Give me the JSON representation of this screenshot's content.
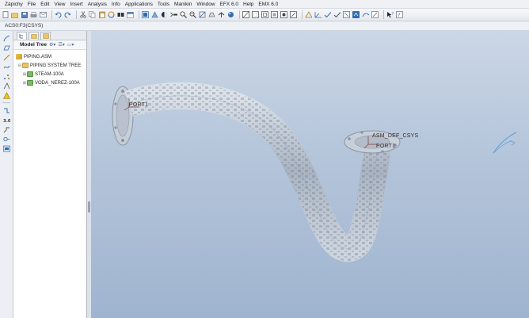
{
  "menu": [
    "Zápichy",
    "File",
    "Edit",
    "View",
    "Insert",
    "Analysis",
    "Info",
    "Applications",
    "Tools",
    "Manikin",
    "Window",
    "EFX 6.0",
    "Help",
    "EMX 6.0"
  ],
  "infobar": {
    "text": "ACS0:F3(CSYS)"
  },
  "tree": {
    "header": "Model Tree",
    "items": [
      {
        "label": "PIPING.ASM",
        "level": 0
      },
      {
        "label": "PIPING SYSTEM TREE",
        "level": 1
      },
      {
        "label": "STEAM-100A",
        "level": 2
      },
      {
        "label": "VODA_NEREZ-100A",
        "level": 2
      }
    ]
  },
  "viewport": {
    "labels": {
      "port1": "PORT1",
      "csys": "ASM_DEF_CSYS",
      "port2": "PORT1"
    }
  },
  "icons": {
    "toolbar": [
      "new-icon",
      "open-icon",
      "save-icon",
      "print-icon",
      "email-icon",
      "undo-icon",
      "redo-icon",
      "cut-icon",
      "copy-icon",
      "paste-icon",
      "regenerate-icon",
      "find-icon",
      "window-icon",
      "shade-icon",
      "repaint-icon",
      "spin-center-icon",
      "zoom-in-icon",
      "zoom-out-icon",
      "refit-icon",
      "reorient-icon",
      "saved-views-icon",
      "layers-icon",
      "appearance-icon",
      "wireframe-icon",
      "hidden-line-icon",
      "no-hidden-icon",
      "shading-icon",
      "datum-planes-icon",
      "datum-axes-icon",
      "datum-points-icon",
      "csys-icon",
      "annotations-icon",
      "context-help-icon"
    ],
    "left": [
      "sketch-icon",
      "arc-icon",
      "line-icon",
      "curve-icon",
      "point-icon",
      "axis-icon",
      "warning-icon",
      "route-icon",
      "dimension-icon",
      "fitting-icon",
      "flange-icon",
      "pipe-info-icon"
    ]
  },
  "colors": {
    "accent": "#2f6db3",
    "pipe": "#aeb8c6"
  }
}
